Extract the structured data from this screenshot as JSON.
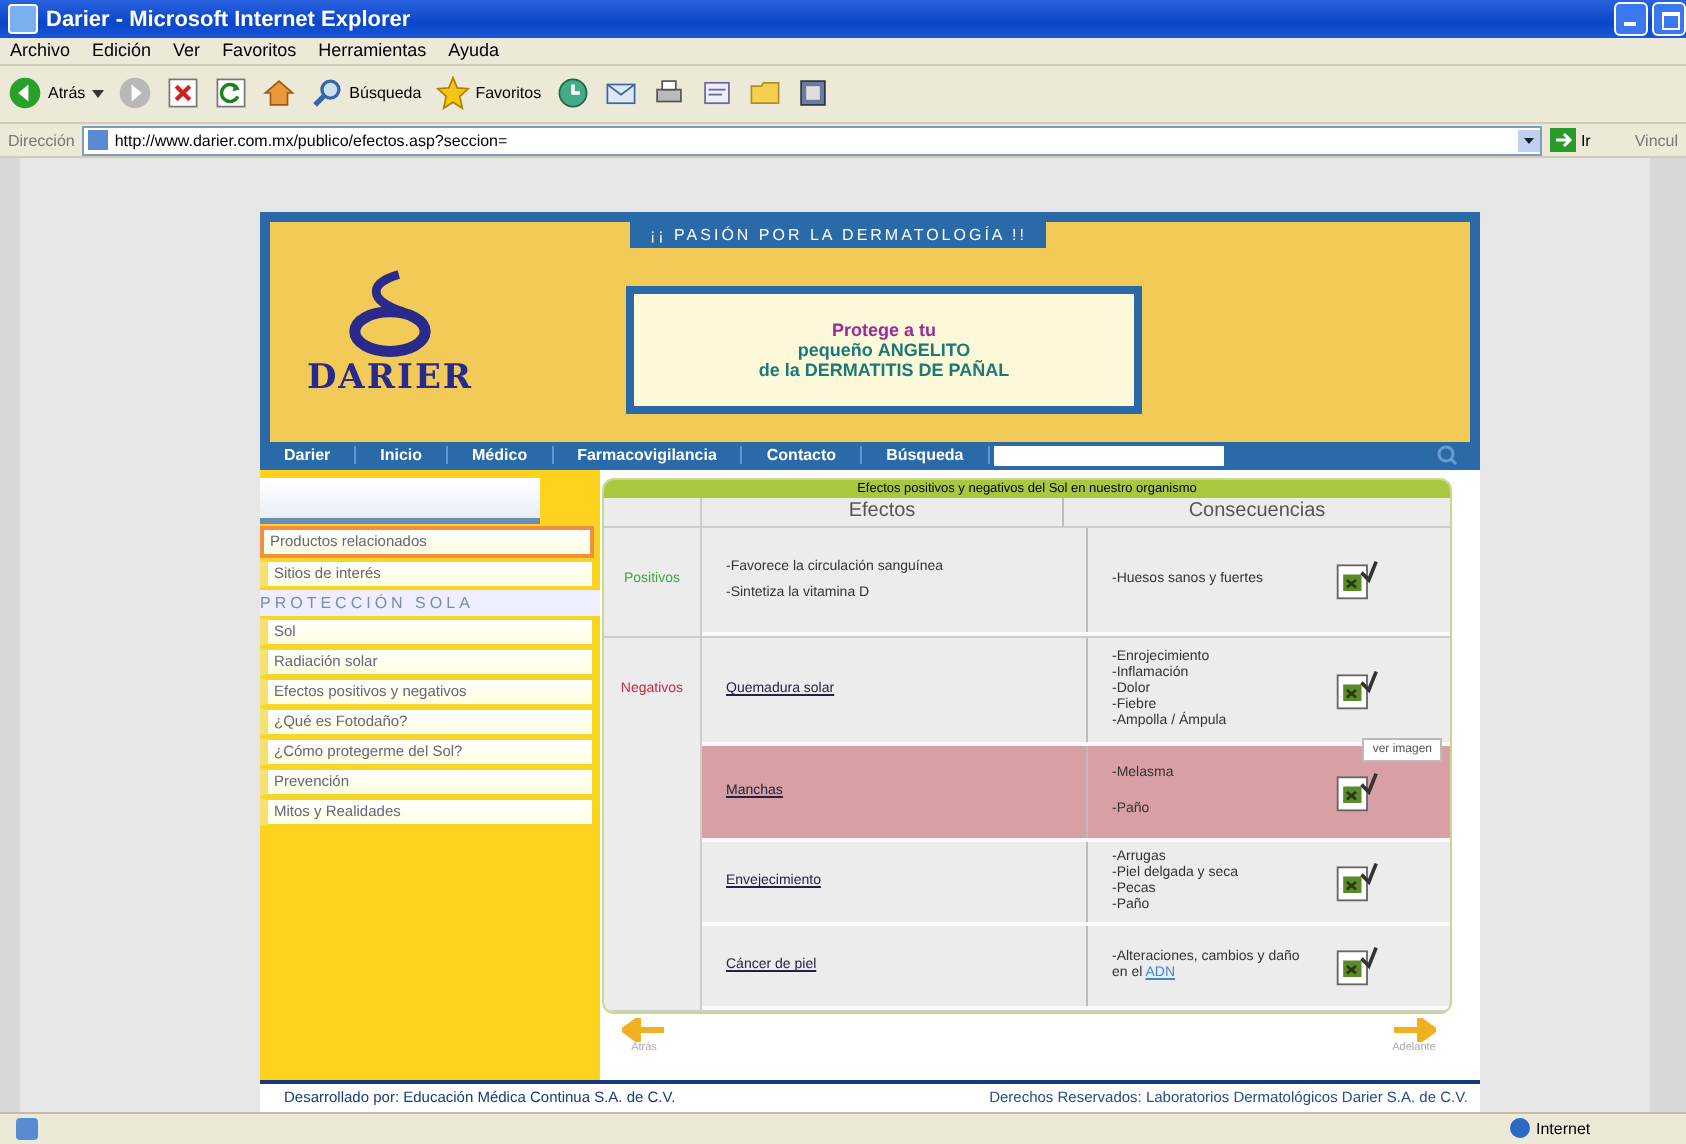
{
  "window": {
    "title": "Darier - Microsoft Internet Explorer"
  },
  "menu": [
    "Archivo",
    "Edición",
    "Ver",
    "Favoritos",
    "Herramientas",
    "Ayuda"
  ],
  "toolbar": {
    "back": "Atrás",
    "search": "Búsqueda",
    "favorites": "Favoritos"
  },
  "address": {
    "label": "Dirección",
    "url": "http://www.darier.com.mx/publico/efectos.asp?seccion=",
    "go": "Ir",
    "links": "Vincul"
  },
  "header": {
    "tagline": "¡¡ PASIÓN POR LA DERMATOLOGÍA !!",
    "logo": "DARIER",
    "banner": [
      "Protege a tu",
      "pequeño **ANGELITO**",
      "de la **DERMATITIS DE PAÑAL**"
    ]
  },
  "nav": [
    {
      "label": "Darier"
    },
    {
      "label": "Inicio"
    },
    {
      "label": "Médico"
    },
    {
      "label": "Farmacovigilancia"
    },
    {
      "label": "Contacto"
    },
    {
      "label": "Búsqueda"
    }
  ],
  "sidebar": {
    "items": [
      {
        "label": "Productos relacionados",
        "selected": true
      },
      {
        "label": "Sitios de interés",
        "selected": false
      }
    ],
    "heading": "PROTECCIÓN SOLA",
    "section_items": [
      {
        "label": "Sol",
        "selected": false
      },
      {
        "label": "Radiación solar",
        "selected": false
      },
      {
        "label": "Efectos positivos y negativos",
        "selected": false
      },
      {
        "label": "¿Qué es Fotodaño?",
        "selected": false
      },
      {
        "label": "¿Cómo protegerme del Sol?",
        "selected": false
      },
      {
        "label": "Prevención",
        "selected": false
      },
      {
        "label": "Mitos y Realidades",
        "selected": false
      }
    ]
  },
  "table": {
    "caption": "Efectos positivos y negativos del Sol en nuestro organismo",
    "columns": [
      "Efectos",
      "Consecuencias"
    ],
    "groups": [
      {
        "label": "Positivos",
        "color": "#3aa83a",
        "rows": [
          {
            "kind": "text",
            "effects": [
              "-Favorece la circulación sanguínea",
              "-Sintetiza la vitamina D"
            ],
            "consequences": [
              {
                "text": "-Huesos sanos y fuertes"
              }
            ],
            "highlighted": false
          }
        ]
      },
      {
        "label": "Negativos",
        "color": "#c8283c",
        "rows": [
          {
            "kind": "link",
            "effects": [
              "Quemadura solar"
            ],
            "consequences": [
              {
                "text": "-Enrojecimiento"
              },
              {
                "text": "-Inflamación"
              },
              {
                "text": "-Dolor"
              },
              {
                "text": "-Fiebre"
              },
              {
                "text": "-Ampolla / Ámpula"
              }
            ],
            "highlighted": false
          },
          {
            "kind": "link",
            "effects": [
              "Manchas"
            ],
            "consequences": [
              {
                "text": "-Melasma"
              },
              {
                "text": "-Paño"
              }
            ],
            "highlighted": true,
            "tooltip": "ver imagen"
          },
          {
            "kind": "link",
            "effects": [
              "Envejecimiento"
            ],
            "consequences": [
              {
                "text": "-Arrugas"
              },
              {
                "text": "-Piel delgada y seca"
              },
              {
                "text": "-Pecas"
              },
              {
                "text": "-Paño"
              }
            ],
            "highlighted": false
          },
          {
            "kind": "link",
            "effects": [
              "Cáncer de piel"
            ],
            "consequences": [
              {
                "text": "-Alteraciones, cambios y daño en el",
                "link": "ADN"
              }
            ],
            "highlighted": false
          }
        ]
      }
    ]
  },
  "pager": {
    "back": "Atrás",
    "forward": "Adelante"
  },
  "footer": {
    "left": "Desarrollado por: Educación Médica Continua S.A. de C.V.",
    "right": "Derechos Reservados: Laboratorios Dermatológicos Darier S.A. de C.V."
  },
  "status_bar": {
    "zone": "Internet"
  }
}
